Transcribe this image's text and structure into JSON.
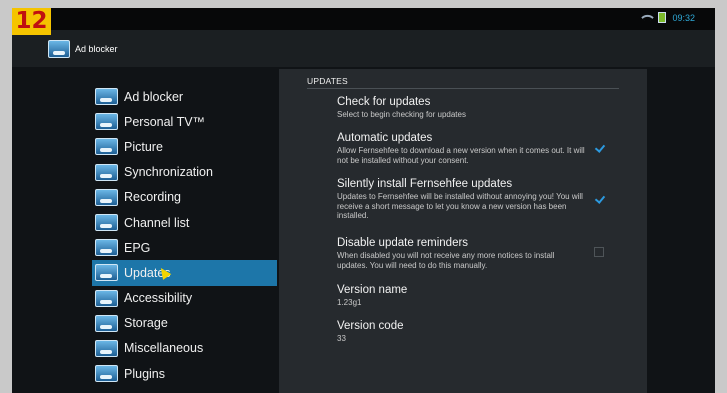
{
  "step_badge": "12",
  "status": {
    "time": "09:32"
  },
  "app": {
    "title": "Ad blocker"
  },
  "sidebar": {
    "items": [
      {
        "label": "Ad blocker"
      },
      {
        "label": "Personal TV™"
      },
      {
        "label": "Picture"
      },
      {
        "label": "Synchronization"
      },
      {
        "label": "Recording"
      },
      {
        "label": "Channel list"
      },
      {
        "label": "EPG"
      },
      {
        "label": "Updates",
        "selected": true
      },
      {
        "label": "Accessibility"
      },
      {
        "label": "Storage"
      },
      {
        "label": "Miscellaneous"
      },
      {
        "label": "Plugins"
      }
    ]
  },
  "panel": {
    "section": "UPDATES",
    "settings": [
      {
        "title": "Check for updates",
        "desc": "Select to begin checking for updates"
      },
      {
        "title": "Automatic updates",
        "desc": "Allow Fernsehfee to download a new version when it comes out. It will not be installed without your consent.",
        "checked": true
      },
      {
        "title": "Silently install Fernsehfee updates",
        "desc": "Updates to Fernsehfee will be installed without annoying you! You will receive a short message to let you know a new version has been installed.",
        "checked": true
      },
      {
        "title": "Disable update reminders",
        "desc": "When disabled you will not receive any more notices to install updates. You will need to do this manually.",
        "checked": false
      },
      {
        "title": "Version name",
        "desc": "1.23g1"
      },
      {
        "title": "Version code",
        "desc": "33"
      }
    ]
  },
  "colors": {
    "accent": "#1d76a9",
    "check": "#2c9ae0",
    "badge_bg": "#f5c400",
    "badge_text": "#c01010"
  }
}
